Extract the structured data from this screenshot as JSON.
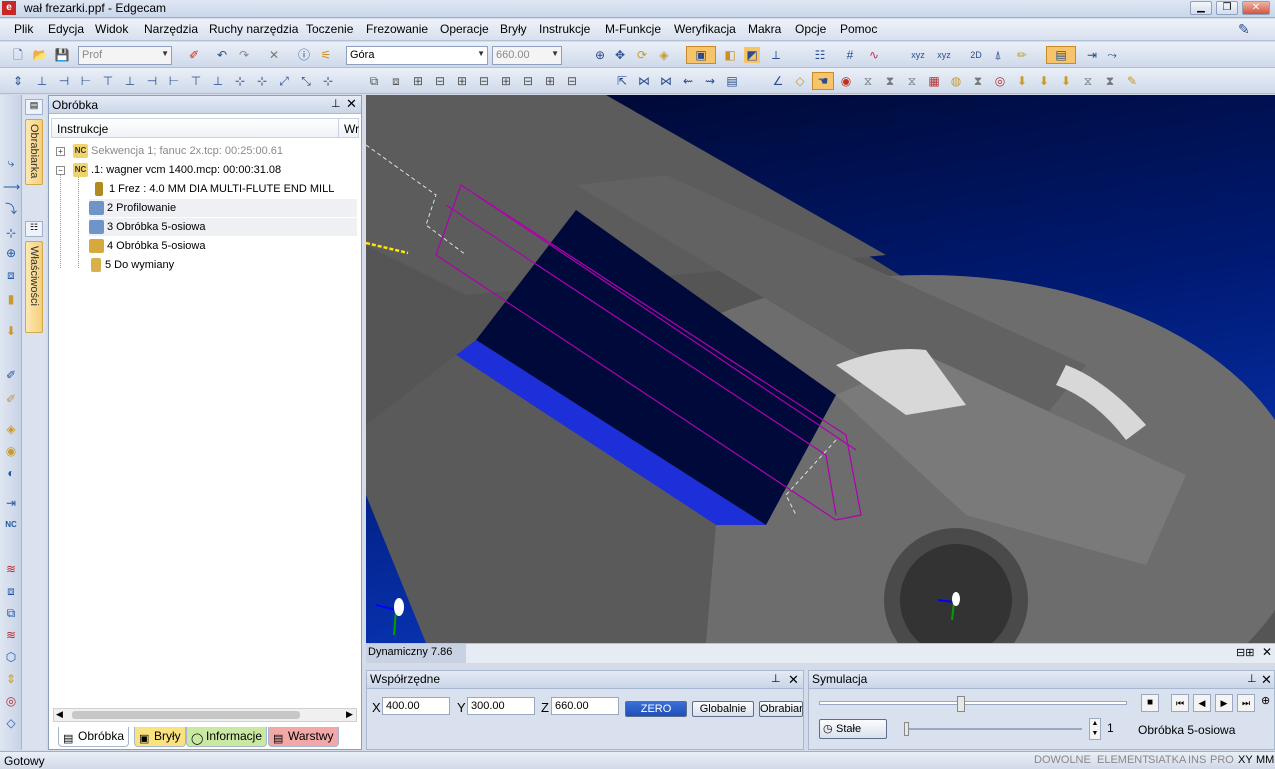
{
  "window": {
    "title": "wał frezarki.ppf - Edgecam",
    "logo": "e",
    "minimize_icon": "minimize-icon",
    "restore_icon": "restore-icon",
    "close_icon": "close-icon"
  },
  "menu": [
    "Plik",
    "Edycja",
    "Widok",
    "Narzędzia",
    "Ruchy narzędzia",
    "Toczenie",
    "Frezowanie",
    "Operacje",
    "Bryły",
    "Instrukcje",
    "M-Funkcje",
    "Weryfikacja",
    "Makra",
    "Opcje",
    "Pomoc"
  ],
  "toolbar": {
    "profile_combo": "Prof",
    "view_combo": "Góra",
    "zlevel_combo": "660.00"
  },
  "sidebar_tabs": {
    "machine": "Obrabiarka",
    "properties": "Właściwości"
  },
  "panel": {
    "title": "Obróbka",
    "pin_icon": "pin-icon",
    "close_icon": "close-icon",
    "column_instructions": "Instrukcje",
    "column_wr": "Wr",
    "tree": [
      {
        "expander": "+",
        "icon": "NC",
        "label": "Sekwencja 1; fanuc 2x.tcp: 00:25:00.61",
        "muted": true
      },
      {
        "expander": "−",
        "icon": "NC",
        "label": ".1: wagner vcm 1400.mcp: 00:00:31.08",
        "muted": false
      },
      {
        "icon": "tool",
        "label": "1 Frez : 4.0 MM DIA MULTI-FLUTE END MILL",
        "muted": false
      },
      {
        "icon": "profile",
        "label": "2 Profilowanie",
        "muted": false
      },
      {
        "icon": "5axis",
        "label": "3 Obróbka 5-osiowa",
        "muted": false
      },
      {
        "icon": "5axis",
        "label": "4 Obróbka 5-osiowa",
        "muted": false
      },
      {
        "icon": "change",
        "label": "5 Do wymiany",
        "muted": false
      }
    ],
    "bottom_tabs": [
      "Obróbka",
      "Bryły",
      "Informacje",
      "Warstwy"
    ]
  },
  "viewport": {
    "status": "Dynamiczny 7.86"
  },
  "coords": {
    "title": "Współrzędne",
    "x_label": "X",
    "x_value": "400.00",
    "y_label": "Y",
    "y_value": "300.00",
    "z_label": "Z",
    "z_value": "660.00",
    "zero_button": "ZERO",
    "global_button": "Globalnie",
    "machine_button": "Obrabiar"
  },
  "simulation": {
    "title": "Symulacja",
    "constant_button": "Stałe",
    "step_value": "1",
    "current_op": "Obróbka 5-osiowa"
  },
  "status": {
    "text": "Gotowy",
    "indicators": [
      "DOWOLNE",
      "ELEMENT",
      "SIATKA",
      "INS",
      "PRO",
      "XY",
      "MM"
    ]
  },
  "colors": {
    "accent": "#2a4d8f",
    "viewport_bg": "#0c3fd1",
    "toolpath": "#b000b0",
    "part_gray": "#6a6a6a"
  }
}
